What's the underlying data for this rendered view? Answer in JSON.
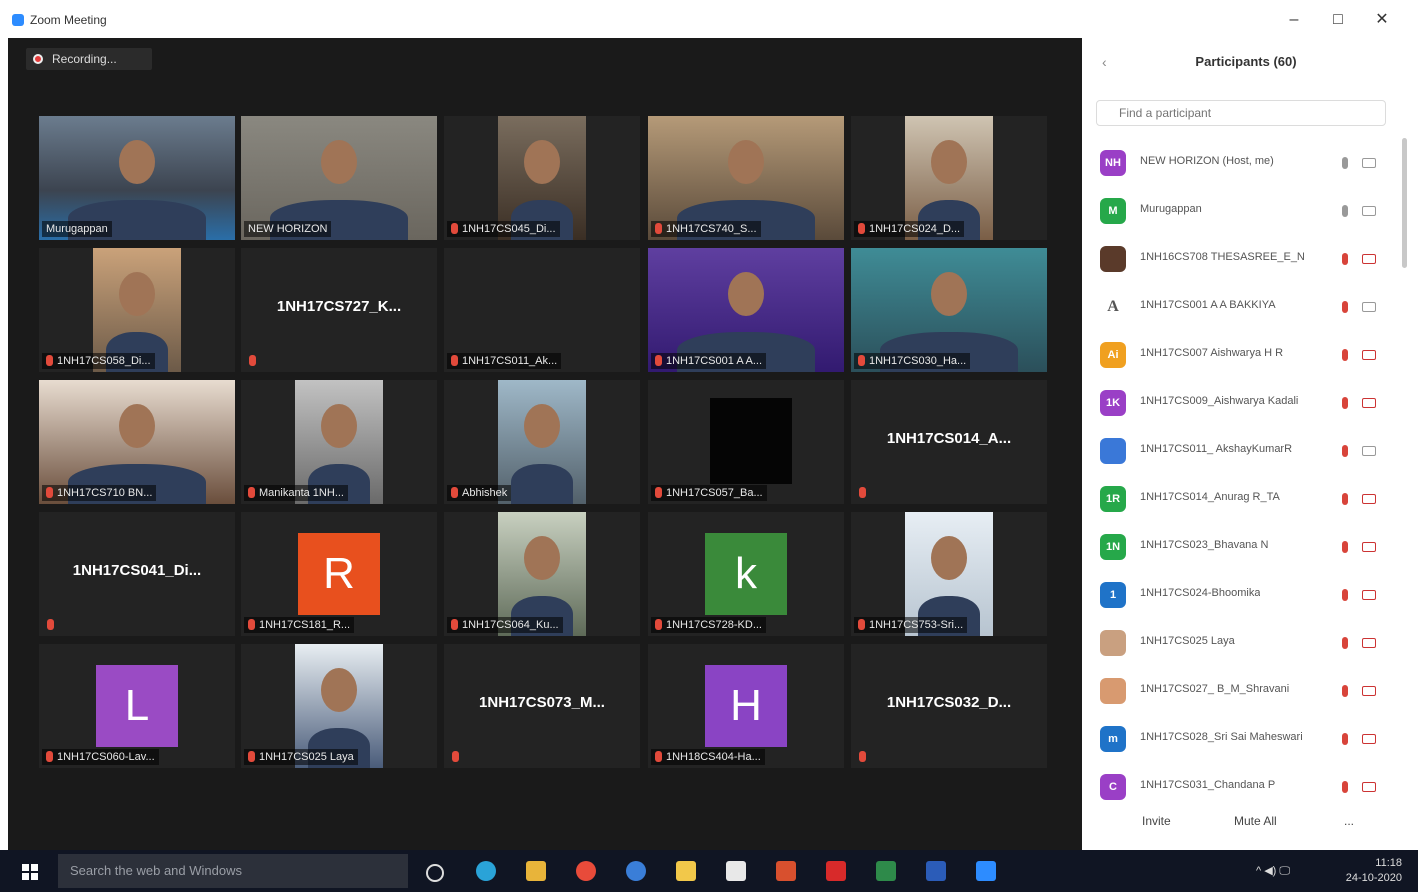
{
  "window": {
    "title": "Zoom Meeting",
    "controls": [
      "–",
      "□",
      "✕"
    ]
  },
  "recording": {
    "label": "Recording..."
  },
  "tiles": [
    {
      "label": "Murugappan",
      "type": "video",
      "bg": "t1"
    },
    {
      "label": "NEW HORIZON",
      "type": "video",
      "bg": "t2",
      "active": true
    },
    {
      "label": "1NH17CS045_Di...",
      "type": "video-narrow",
      "bg": "t3"
    },
    {
      "label": "1NH17CS740_S...",
      "type": "video",
      "bg": "t4"
    },
    {
      "label": "1NH17CS024_D...",
      "type": "video-narrow",
      "bg": "t5"
    },
    {
      "label": "1NH17CS058_Di...",
      "type": "video-narrow",
      "bg": "t6"
    },
    {
      "center": "1NH17CS727_K...",
      "type": "name"
    },
    {
      "label": "1NH17CS011_Ak...",
      "type": "blank"
    },
    {
      "label": "1NH17CS001 A A...",
      "type": "video",
      "bg": "t9"
    },
    {
      "label": "1NH17CS030_Ha...",
      "type": "video",
      "bg": "t10"
    },
    {
      "label": "1NH17CS710 BN...",
      "type": "video",
      "bg": "t11"
    },
    {
      "label": "Manikanta 1NH...",
      "type": "video-narrow",
      "bg": "t12"
    },
    {
      "label": "Abhishek",
      "type": "video-narrow",
      "bg": "t13"
    },
    {
      "label": "1NH17CS057_Ba...",
      "type": "black",
      "bg": "t14"
    },
    {
      "center": "1NH17CS014_A...",
      "type": "name"
    },
    {
      "center": "1NH17CS041_Di...",
      "type": "name"
    },
    {
      "label": "1NH17CS181_R...",
      "type": "letter",
      "letter": "R",
      "color": "#e8501e"
    },
    {
      "label": "1NH17CS064_Ku...",
      "type": "video-narrow",
      "bg": "t18"
    },
    {
      "label": "1NH17CS728-KD...",
      "type": "letter",
      "letter": "k",
      "color": "#3a8a3a"
    },
    {
      "label": "1NH17CS753-Sri...",
      "type": "video-narrow",
      "bg": "t20"
    },
    {
      "label": "1NH17CS060-Lav...",
      "type": "letter",
      "letter": "L",
      "color": "#9a4bc4"
    },
    {
      "label": "1NH17CS025 Laya",
      "type": "video-narrow",
      "bg": "t22"
    },
    {
      "center": "1NH17CS073_M...",
      "type": "name"
    },
    {
      "label": "1NH18CS404-Ha...",
      "type": "letter",
      "letter": "H",
      "color": "#8a44c4"
    },
    {
      "center": "1NH17CS032_D...",
      "type": "name"
    }
  ],
  "panel": {
    "title": "Participants (60)",
    "search_placeholder": "Find a participant",
    "participants": [
      {
        "initials": "NH",
        "color": "#9a3fc6",
        "name": "NEW HORIZON (Host, me)",
        "mic": "on",
        "cam": "on"
      },
      {
        "initials": "M",
        "color": "#26a84a",
        "name": "Murugappan",
        "mic": "on",
        "cam": "on"
      },
      {
        "initials": "",
        "color": "#5a3a2a",
        "name": "1NH16CS708 THESASREE_E_N",
        "mic": "off",
        "cam": "off"
      },
      {
        "initials": "A",
        "color": "#ffffff",
        "name": "1NH17CS001 A A BAKKIYA",
        "mic": "off",
        "cam": "on"
      },
      {
        "initials": "Ai",
        "color": "#f0a020",
        "name": "1NH17CS007 Aishwarya H R",
        "mic": "off",
        "cam": "off"
      },
      {
        "initials": "1K",
        "color": "#9a3fc6",
        "name": "1NH17CS009_Aishwarya Kadali",
        "mic": "off",
        "cam": "off"
      },
      {
        "initials": "",
        "color": "#3a78d8",
        "name": "1NH17CS011_ AkshayKumarR",
        "mic": "off",
        "cam": "on"
      },
      {
        "initials": "1R",
        "color": "#26a84a",
        "name": "1NH17CS014_Anurag R_TA",
        "mic": "off",
        "cam": "off"
      },
      {
        "initials": "1N",
        "color": "#26a84a",
        "name": "1NH17CS023_Bhavana N",
        "mic": "off",
        "cam": "off"
      },
      {
        "initials": "1",
        "color": "#1f73c8",
        "name": "1NH17CS024-Bhoomika",
        "mic": "off",
        "cam": "off"
      },
      {
        "initials": "",
        "color": "#c9a080",
        "name": "1NH17CS025 Laya",
        "mic": "off",
        "cam": "off"
      },
      {
        "initials": "",
        "color": "#d89a70",
        "name": "1NH17CS027_ B_M_Shravani",
        "mic": "off",
        "cam": "off"
      },
      {
        "initials": "m",
        "color": "#1f73c8",
        "name": "1NH17CS028_Sri Sai Maheswari",
        "mic": "off",
        "cam": "off"
      },
      {
        "initials": "C",
        "color": "#9a3fc6",
        "name": "1NH17CS031_Chandana P",
        "mic": "off",
        "cam": "off"
      }
    ],
    "footer": {
      "invite": "Invite",
      "mute_all": "Mute All",
      "more": "..."
    }
  },
  "taskbar": {
    "search_text": "Search the web and Windows",
    "time": "11:18",
    "date": "24-10-2020",
    "tray": "^ ◀) 🖵"
  }
}
